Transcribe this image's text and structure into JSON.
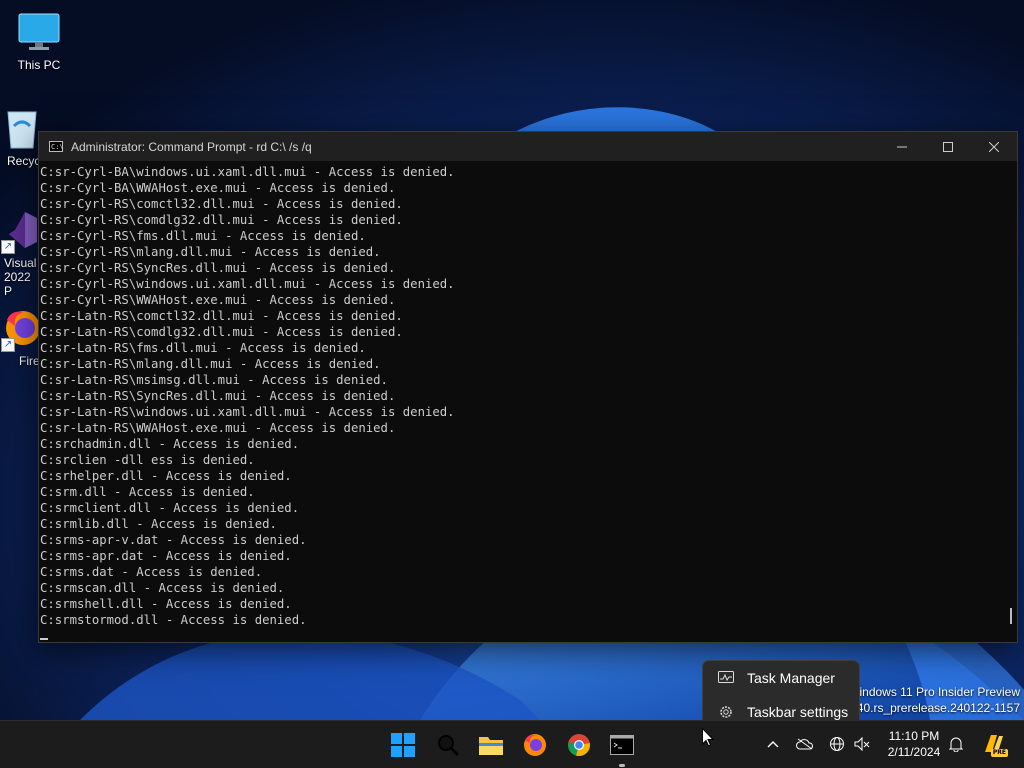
{
  "desktop": {
    "icons": [
      {
        "label": "This PC",
        "icon": "monitor-icon"
      },
      {
        "label": "Recyc",
        "icon": "recycle-bin-icon"
      },
      {
        "label": "Visual",
        "label2": "2022 P",
        "icon": "visual-studio-icon"
      },
      {
        "label": "Fire",
        "icon": "firefox-icon"
      }
    ]
  },
  "window": {
    "title": "Administrator: Command Prompt - rd  C:\\ /s /q",
    "console_lines": [
      "C:sr-Cyrl-BA\\windows.ui.xaml.dll.mui - Access is denied.",
      "C:sr-Cyrl-BA\\WWAHost.exe.mui - Access is denied.",
      "C:sr-Cyrl-RS\\comctl32.dll.mui - Access is denied.",
      "C:sr-Cyrl-RS\\comdlg32.dll.mui - Access is denied.",
      "C:sr-Cyrl-RS\\fms.dll.mui - Access is denied.",
      "C:sr-Cyrl-RS\\mlang.dll.mui - Access is denied.",
      "C:sr-Cyrl-RS\\SyncRes.dll.mui - Access is denied.",
      "C:sr-Cyrl-RS\\windows.ui.xaml.dll.mui - Access is denied.",
      "C:sr-Cyrl-RS\\WWAHost.exe.mui - Access is denied.",
      "C:sr-Latn-RS\\comctl32.dll.mui - Access is denied.",
      "C:sr-Latn-RS\\comdlg32.dll.mui - Access is denied.",
      "C:sr-Latn-RS\\fms.dll.mui - Access is denied.",
      "C:sr-Latn-RS\\mlang.dll.mui - Access is denied.",
      "C:sr-Latn-RS\\msimsg.dll.mui - Access is denied.",
      "C:sr-Latn-RS\\SyncRes.dll.mui - Access is denied.",
      "C:sr-Latn-RS\\windows.ui.xaml.dll.mui - Access is denied.",
      "C:sr-Latn-RS\\WWAHost.exe.mui - Access is denied.",
      "C:srchadmin.dll - Access is denied.",
      "C:srclien -dll ess is denied.",
      "C:srhelper.dll - Access is denied.",
      "C:srm.dll - Access is denied.",
      "C:srmclient.dll - Access is denied.",
      "C:srmlib.dll - Access is denied.",
      "C:srms-apr-v.dat - Access is denied.",
      "C:srms-apr.dat - Access is denied.",
      "C:srms.dat - Access is denied.",
      "C:srmscan.dll - Access is denied.",
      "C:srmshell.dll - Access is denied.",
      "C:srmstormod.dll - Access is denied."
    ]
  },
  "watermark": {
    "line1": "Windows 11 Pro Insider Preview",
    "line2": "6040.rs_prerelease.240122-1157"
  },
  "context_menu": {
    "items": [
      {
        "label": "Task Manager",
        "icon": "task-manager-icon"
      },
      {
        "label": "Taskbar settings",
        "icon": "gear-icon"
      }
    ]
  },
  "taskbar": {
    "apps": [
      "start-icon",
      "search-icon",
      "file-explorer-icon",
      "firefox-icon",
      "chrome-icon",
      "command-prompt-icon"
    ],
    "tray": [
      "chevron-up-icon",
      "onedrive-icon",
      "network-icon",
      "volume-muted-icon",
      "notification-bell-icon",
      "copilot-icon"
    ],
    "time": "11:10 PM",
    "date": "2/11/2024",
    "copilot_badge": "PRE"
  },
  "colors": {
    "console_bg": "#0c0c0c",
    "console_fg": "#cccccc",
    "taskbar_bg": "#1c1c1c",
    "titlebar_bg": "#202020"
  }
}
